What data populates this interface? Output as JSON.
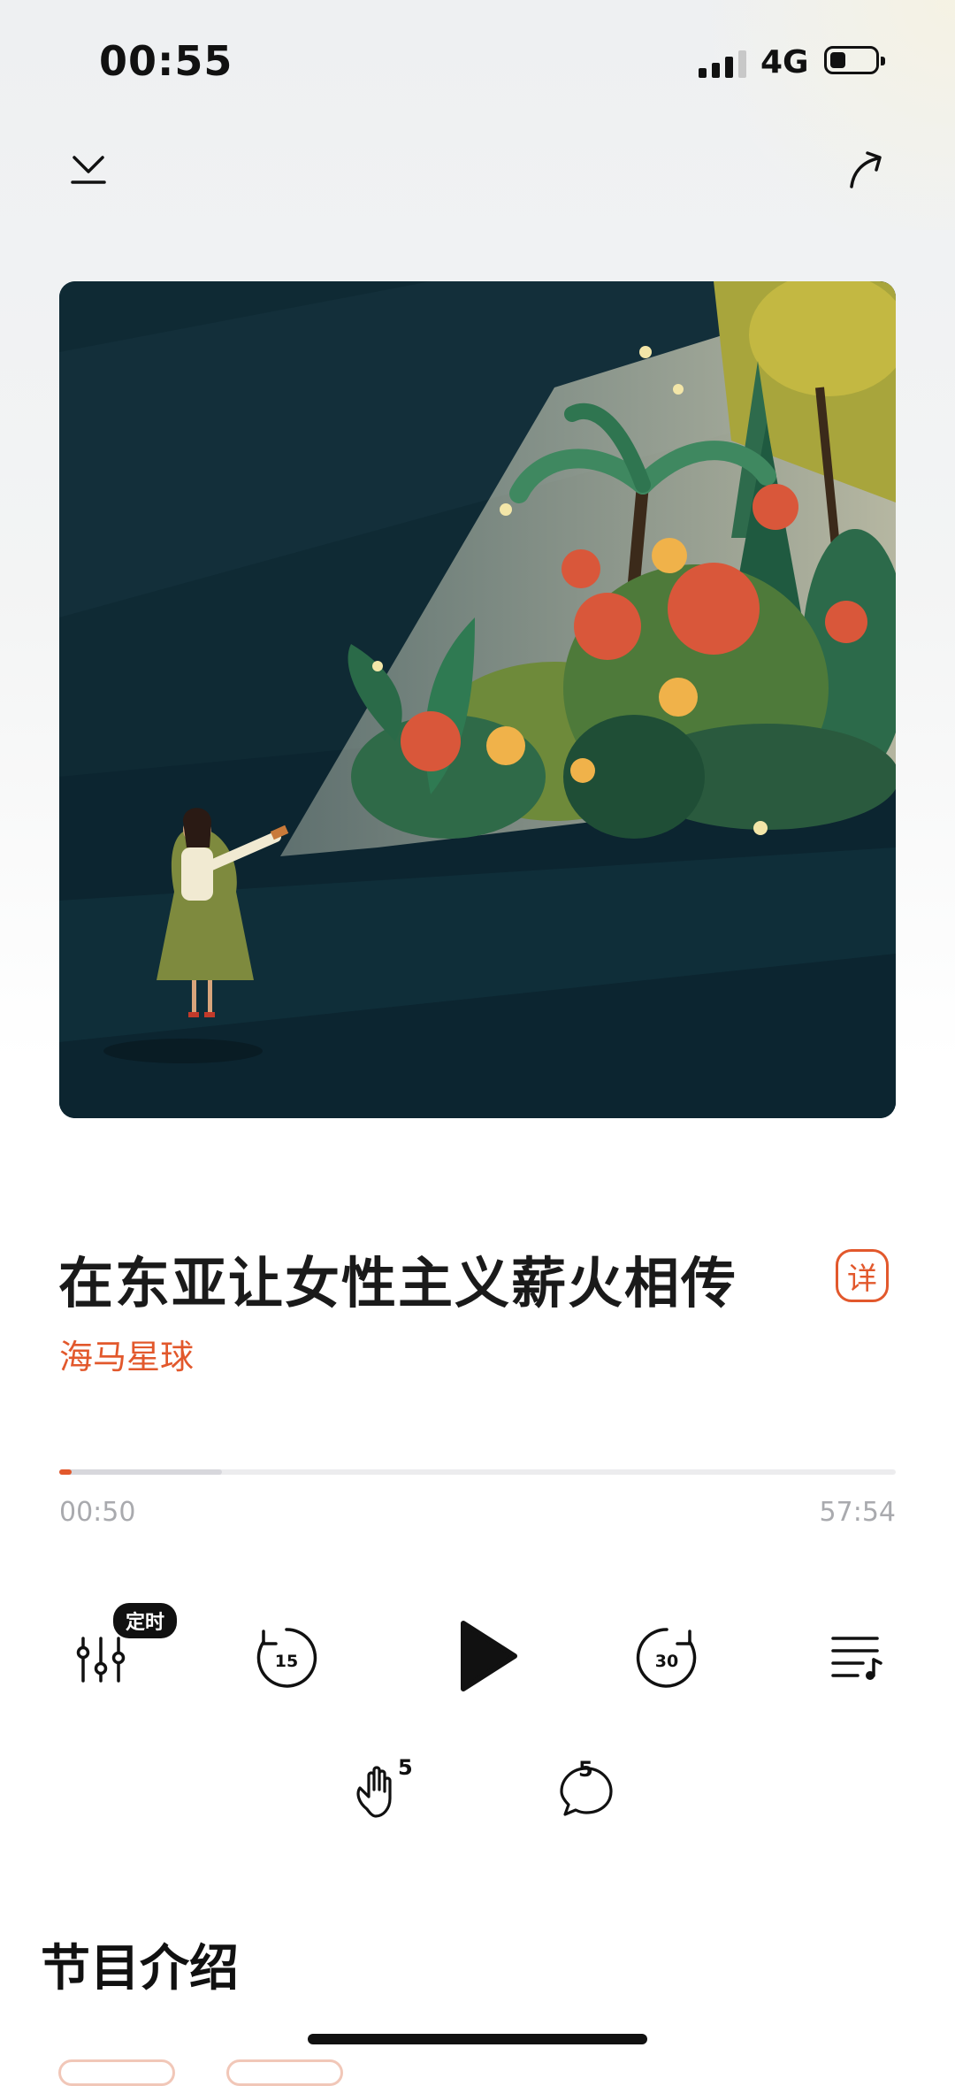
{
  "status_bar": {
    "time": "00:55",
    "network": "4G"
  },
  "header": {
    "collapse_icon": "chevron-down-icon",
    "share_icon": "share-arrow-icon"
  },
  "episode": {
    "title": "在东亚让女性主义薪火相传",
    "detail_label": "详",
    "author": "海马星球"
  },
  "playback": {
    "current_time": "00:50",
    "total_time": "57:54",
    "played_fraction": 0.0144,
    "buffered_fraction": 0.195
  },
  "controls": {
    "timer_badge": "定时",
    "rewind_seconds": "15",
    "forward_seconds": "30",
    "like_count": "5",
    "comment_count": "5"
  },
  "intro": {
    "section_title": "节目介绍"
  },
  "colors": {
    "accent": "#e2582c",
    "cover_bg": "#0f2a34"
  }
}
